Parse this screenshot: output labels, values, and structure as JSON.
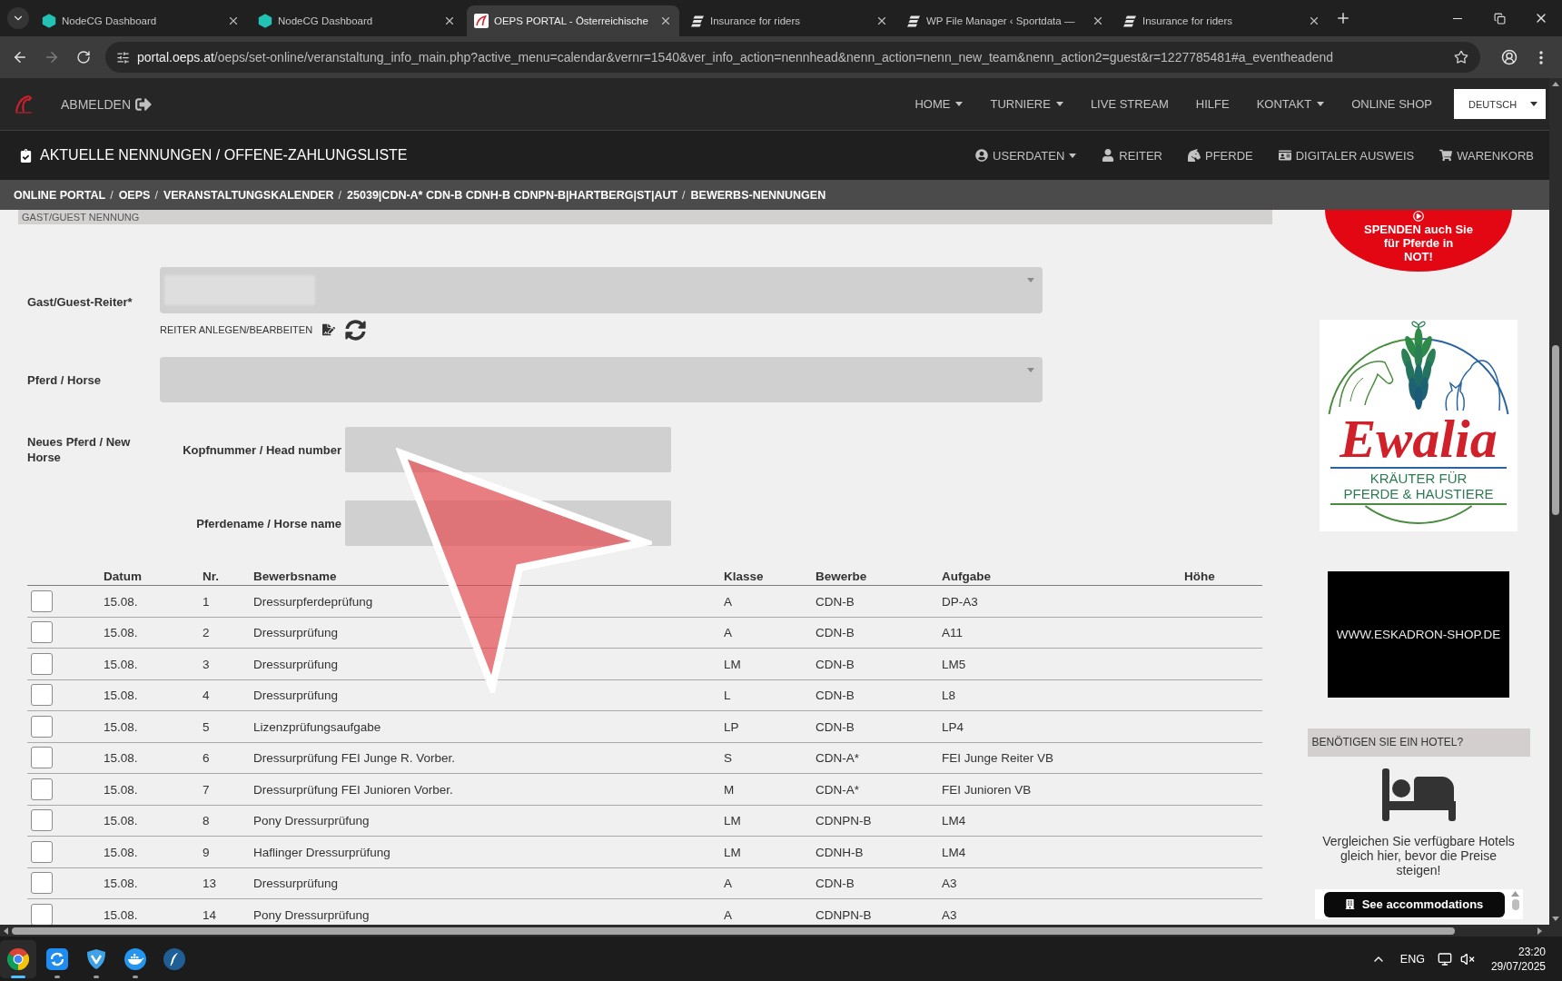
{
  "browser": {
    "tabs": [
      {
        "title": "NodeCG Dashboard",
        "kind": "nodecg",
        "selected": false
      },
      {
        "title": "NodeCG Dashboard",
        "kind": "nodecg",
        "selected": false
      },
      {
        "title": "OEPS PORTAL - Österreichische",
        "kind": "oeps",
        "selected": true
      },
      {
        "title": "Insurance for riders",
        "kind": "sportdata",
        "selected": false
      },
      {
        "title": "WP File Manager ‹ Sportdata —",
        "kind": "sportdata",
        "selected": false
      },
      {
        "title": "Insurance for riders",
        "kind": "sportdata",
        "selected": false
      }
    ],
    "forward_disabled": true,
    "address": {
      "host": "portal.oeps.at",
      "path": "/oeps/set-online/veranstaltung_info_main.php?active_menu=calendar&vernr=1540&ver_info_action=nennhead&nenn_action=nenn_new_team&nenn_action2=guest&r=1227785481#a_eventheadend"
    }
  },
  "site_nav": {
    "logout": "ABMELDEN",
    "items": [
      {
        "label": "HOME",
        "dropdown": true
      },
      {
        "label": "TURNIERE",
        "dropdown": true
      },
      {
        "label": "LIVE STREAM",
        "dropdown": false
      },
      {
        "label": "HILFE",
        "dropdown": false
      },
      {
        "label": "KONTAKT",
        "dropdown": true
      },
      {
        "label": "ONLINE SHOP",
        "dropdown": false
      }
    ],
    "language": "DEUTSCH"
  },
  "sub_nav": {
    "title": "AKTUELLE NENNUNGEN / OFFENE-ZAHLUNGSLISTE",
    "items": [
      {
        "label": "USERDATEN",
        "kind": "account",
        "dropdown": true
      },
      {
        "label": "REITER",
        "kind": "rider",
        "dropdown": false
      },
      {
        "label": "PFERDE",
        "kind": "horse",
        "dropdown": false
      },
      {
        "label": "DIGITALER AUSWEIS",
        "kind": "id-card",
        "dropdown": false
      },
      {
        "label": "WARENKORB",
        "kind": "cart",
        "dropdown": false
      }
    ]
  },
  "breadcrumb": {
    "separator": "/",
    "items": [
      "ONLINE PORTAL",
      "OEPS",
      "VERANSTALTUNGSKALENDER",
      "25039|CDN-A* CDN-B CDNH-B CDNPN-B|HARTBERG|ST|AUT",
      "BEWERBS-NENNUNGEN"
    ]
  },
  "form": {
    "title": "GAST/GUEST NENNUNG",
    "rider": {
      "label": "Gast/Guest-Reiter*",
      "value_blurred": true
    },
    "rider_link": "REITER ANLEGEN/BEARBEITEN",
    "horse": {
      "label": "Pferd / Horse"
    },
    "new_horse": {
      "label": "Neues Pferd / New Horse",
      "fields": [
        {
          "label": "Kopfnummer / Head number"
        },
        {
          "label": "Pferdename / Horse name"
        }
      ]
    }
  },
  "table": {
    "columns": [
      "Datum",
      "Nr.",
      "Bewerbsname",
      "Klasse",
      "Bewerbe",
      "Aufgabe",
      "Höhe"
    ],
    "rows": [
      {
        "checked": false,
        "cells": [
          "15.08.",
          "1",
          "Dressurpferdeprüfung",
          "A",
          "CDN-B",
          "DP-A3"
        ]
      },
      {
        "checked": false,
        "cells": [
          "15.08.",
          "2",
          "Dressurprüfung",
          "A",
          "CDN-B",
          "A11"
        ]
      },
      {
        "checked": false,
        "cells": [
          "15.08.",
          "3",
          "Dressurprüfung",
          "LM",
          "CDN-B",
          "LM5"
        ]
      },
      {
        "checked": false,
        "cells": [
          "15.08.",
          "4",
          "Dressurprüfung",
          "L",
          "CDN-B",
          "L8"
        ]
      },
      {
        "checked": false,
        "cells": [
          "15.08.",
          "5",
          "Lizenzprüfungsaufgabe",
          "LP",
          "CDN-B",
          "LP4"
        ]
      },
      {
        "checked": false,
        "cells": [
          "15.08.",
          "6",
          "Dressurprüfung FEI Junge R. Vorber.",
          "S",
          "CDN-A*",
          "FEI Junge Reiter VB"
        ]
      },
      {
        "checked": false,
        "cells": [
          "15.08.",
          "7",
          "Dressurprüfung FEI Junioren Vorber.",
          "M",
          "CDN-A*",
          "FEI Junioren VB"
        ]
      },
      {
        "checked": false,
        "cells": [
          "15.08.",
          "8",
          "Pony Dressurprüfung",
          "LM",
          "CDNPN-B",
          "LM4"
        ]
      },
      {
        "checked": false,
        "cells": [
          "15.08.",
          "9",
          "Haflinger Dressurprüfung",
          "LM",
          "CDNH-B",
          "LM4"
        ]
      },
      {
        "checked": false,
        "cells": [
          "15.08.",
          "13",
          "Dressurprüfung",
          "A",
          "CDN-B",
          "A3"
        ]
      },
      {
        "checked": false,
        "cells": [
          "15.08.",
          "14",
          "Pony Dressurprüfung",
          "A",
          "CDNPN-B",
          "A3"
        ]
      }
    ]
  },
  "sidebar": {
    "donation": {
      "text": "SPENDEN auch Sie\nfür Pferde in\nNOT!"
    },
    "herbs_ad": {
      "brand": "Ewalia",
      "tagline": "KRÄUTER FÜR\nPFERDE & HAUSTIERE"
    },
    "shop_ad": {
      "text": "WWW.ESKADRON-SHOP.DE"
    },
    "hotel": {
      "title": "BENÖTIGEN SIE EIN HOTEL?",
      "text": "Vergleichen Sie verfügbare Hotels gleich hier, bevor die Preise steigen!",
      "button": "See accommodations"
    }
  },
  "taskbar": {
    "apps": [
      {
        "kind": "chrome",
        "running": true,
        "active": true
      },
      {
        "kind": "sync",
        "running": true,
        "active": false
      },
      {
        "kind": "shield",
        "running": true,
        "active": false
      },
      {
        "kind": "whale",
        "running": true,
        "active": false
      },
      {
        "kind": "feather",
        "running": false,
        "active": false
      }
    ],
    "language": "ENG",
    "volume_muted": true,
    "time": "23:20",
    "date": "29/07/2025"
  }
}
